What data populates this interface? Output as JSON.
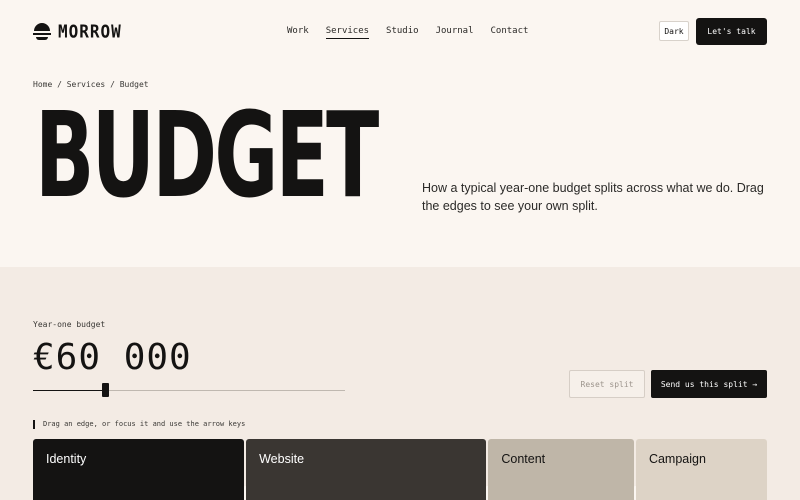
{
  "brand": {
    "name": "MORROW",
    "logo_icon": "hat-logo-icon"
  },
  "nav": {
    "items": [
      {
        "label": "Work"
      },
      {
        "label": "Services",
        "active": true
      },
      {
        "label": "Studio"
      },
      {
        "label": "Journal"
      },
      {
        "label": "Contact"
      }
    ]
  },
  "header": {
    "theme_toggle_label": "Dark",
    "cta_label": "Let's talk"
  },
  "breadcrumb": "Home / Services / Budget",
  "hero": {
    "title": "BUDGET",
    "description": "How a typical year-one budget splits across what we do. Drag the edges to see your own split."
  },
  "budget": {
    "label": "Year-one budget",
    "amount": "€60 000",
    "slider_fraction": 0.23
  },
  "actions": {
    "reset_label": "Reset split",
    "send_label": "Send us this split →"
  },
  "hint": "Drag an edge, or focus it and use the arrow keys",
  "split": {
    "segments": [
      {
        "label": "Identity",
        "share": 29,
        "color": "#141312",
        "text_color": "#ffffff"
      },
      {
        "label": "Website",
        "share": 33,
        "color": "#3a3632",
        "text_color": "#ffffff"
      },
      {
        "label": "Content",
        "share": 20,
        "color": "#bfb6a8",
        "text_color": "#141312"
      },
      {
        "label": "Campaign",
        "share": 18,
        "color": "#ddd3c6",
        "text_color": "#141312"
      }
    ]
  }
}
